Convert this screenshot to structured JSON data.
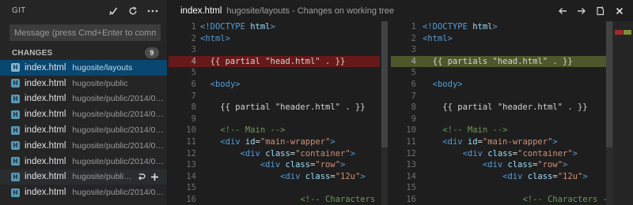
{
  "sidebar": {
    "title": "GIT",
    "actions": [
      {
        "name": "commit-check-icon",
        "glyph": "✓"
      },
      {
        "name": "refresh-icon",
        "glyph": "↻"
      },
      {
        "name": "more-icon",
        "glyph": "···"
      }
    ],
    "commit_placeholder": "Message (press Cmd+Enter to commit)",
    "changes_label": "CHANGES",
    "changes_count": "9",
    "files": [
      {
        "name": "index.html",
        "path": "hugosite/layouts",
        "state": "selected"
      },
      {
        "name": "index.html",
        "path": "hugosite/public",
        "state": ""
      },
      {
        "name": "index.html",
        "path": "hugosite/public/2014/04/s...",
        "state": ""
      },
      {
        "name": "index.html",
        "path": "hugosite/public/2014/04/s...",
        "state": ""
      },
      {
        "name": "index.html",
        "path": "hugosite/public/2014/04/s...",
        "state": ""
      },
      {
        "name": "index.html",
        "path": "hugosite/public/2014/05/s...",
        "state": ""
      },
      {
        "name": "index.html",
        "path": "hugosite/public/2014/05/s...",
        "state": ""
      },
      {
        "name": "index.html",
        "path": "hugosite/public/...",
        "state": "hover"
      },
      {
        "name": "index.html",
        "path": "hugosite/public/2014/06/s...",
        "state": ""
      }
    ]
  },
  "editor": {
    "file_name": "index.html",
    "description": "hugosite/layouts - Changes on working tree",
    "actions": [
      {
        "name": "previous-change-icon",
        "glyph": "←"
      },
      {
        "name": "next-change-icon",
        "glyph": "→"
      },
      {
        "name": "open-file-icon",
        "glyph": "⎘"
      },
      {
        "name": "close-icon",
        "glyph": "✕"
      }
    ],
    "left_lines": [
      {
        "n": "1",
        "t": [
          [
            "kw",
            "<!DOCTYPE "
          ],
          [
            "attr",
            "html"
          ],
          [
            "kw",
            ">"
          ]
        ]
      },
      {
        "n": "2",
        "t": [
          [
            "tag",
            "<html>"
          ]
        ]
      },
      {
        "n": "3",
        "t": []
      },
      {
        "n": "4",
        "k": "del",
        "t": [
          [
            "plain",
            "  {{ partial \"head.html\" . }}"
          ]
        ]
      },
      {
        "n": "5",
        "t": []
      },
      {
        "n": "6",
        "t": [
          [
            "plain",
            "  "
          ],
          [
            "tag",
            "<body>"
          ]
        ]
      },
      {
        "n": "7",
        "t": []
      },
      {
        "n": "8",
        "t": [
          [
            "plain",
            "    {{ partial \"header.html\" . }}"
          ]
        ]
      },
      {
        "n": "9",
        "t": []
      },
      {
        "n": "10",
        "t": [
          [
            "plain",
            "    "
          ],
          [
            "com",
            "<!-- Main -->"
          ]
        ]
      },
      {
        "n": "11",
        "t": [
          [
            "plain",
            "    "
          ],
          [
            "tag",
            "<div "
          ],
          [
            "attr",
            "id"
          ],
          [
            "plain",
            "="
          ],
          [
            "str",
            "\"main-wrapper\""
          ],
          [
            "tag",
            ">"
          ]
        ]
      },
      {
        "n": "12",
        "t": [
          [
            "plain",
            "        "
          ],
          [
            "tag",
            "<div "
          ],
          [
            "attr",
            "class"
          ],
          [
            "plain",
            "="
          ],
          [
            "str",
            "\"container\""
          ],
          [
            "tag",
            ">"
          ]
        ]
      },
      {
        "n": "13",
        "t": [
          [
            "plain",
            "            "
          ],
          [
            "tag",
            "<div "
          ],
          [
            "attr",
            "class"
          ],
          [
            "plain",
            "="
          ],
          [
            "str",
            "\"row\""
          ],
          [
            "tag",
            ">"
          ]
        ]
      },
      {
        "n": "14",
        "t": [
          [
            "plain",
            "                "
          ],
          [
            "tag",
            "<div "
          ],
          [
            "attr",
            "class"
          ],
          [
            "plain",
            "="
          ],
          [
            "str",
            "\"12u\""
          ],
          [
            "tag",
            ">"
          ]
        ]
      },
      {
        "n": "15",
        "t": []
      },
      {
        "n": "16",
        "t": [
          [
            "plain",
            "                    "
          ],
          [
            "com",
            "<!-- Characters -->"
          ]
        ]
      }
    ],
    "right_lines": [
      {
        "n": "1",
        "t": [
          [
            "kw",
            "<!DOCTYPE "
          ],
          [
            "attr",
            "html"
          ],
          [
            "kw",
            ">"
          ]
        ]
      },
      {
        "n": "2",
        "t": [
          [
            "tag",
            "<html>"
          ]
        ]
      },
      {
        "n": "3",
        "t": []
      },
      {
        "n": "4",
        "k": "add",
        "t": [
          [
            "plain",
            "  {{ partials \"head.html\" . }}"
          ]
        ]
      },
      {
        "n": "5",
        "t": []
      },
      {
        "n": "6",
        "t": [
          [
            "plain",
            "  "
          ],
          [
            "tag",
            "<body>"
          ]
        ]
      },
      {
        "n": "7",
        "t": []
      },
      {
        "n": "8",
        "t": [
          [
            "plain",
            "    {{ partial \"header.html\" . }}"
          ]
        ]
      },
      {
        "n": "9",
        "t": []
      },
      {
        "n": "10",
        "t": [
          [
            "plain",
            "    "
          ],
          [
            "com",
            "<!-- Main -->"
          ]
        ]
      },
      {
        "n": "11",
        "t": [
          [
            "plain",
            "    "
          ],
          [
            "tag",
            "<div "
          ],
          [
            "attr",
            "id"
          ],
          [
            "plain",
            "="
          ],
          [
            "str",
            "\"main-wrapper\""
          ],
          [
            "tag",
            ">"
          ]
        ]
      },
      {
        "n": "12",
        "t": [
          [
            "plain",
            "        "
          ],
          [
            "tag",
            "<div "
          ],
          [
            "attr",
            "class"
          ],
          [
            "plain",
            "="
          ],
          [
            "str",
            "\"container\""
          ],
          [
            "tag",
            ">"
          ]
        ]
      },
      {
        "n": "13",
        "t": [
          [
            "plain",
            "            "
          ],
          [
            "tag",
            "<div "
          ],
          [
            "attr",
            "class"
          ],
          [
            "plain",
            "="
          ],
          [
            "str",
            "\"row\""
          ],
          [
            "tag",
            ">"
          ]
        ]
      },
      {
        "n": "14",
        "t": [
          [
            "plain",
            "                "
          ],
          [
            "tag",
            "<div "
          ],
          [
            "attr",
            "class"
          ],
          [
            "plain",
            "="
          ],
          [
            "str",
            "\"12u\""
          ],
          [
            "tag",
            ">"
          ]
        ]
      },
      {
        "n": "15",
        "t": []
      },
      {
        "n": "16",
        "t": [
          [
            "plain",
            "                    "
          ],
          [
            "com",
            "<!-- Characters -->"
          ]
        ]
      }
    ]
  },
  "colors": {
    "removed_line": "#7c1818",
    "added_line": "#606e30",
    "selection": "#094771",
    "overview_removed": "#a12a2a",
    "overview_added": "#7d8f3a"
  },
  "row_action_icons": [
    "discard-icon",
    "stage-icon"
  ]
}
